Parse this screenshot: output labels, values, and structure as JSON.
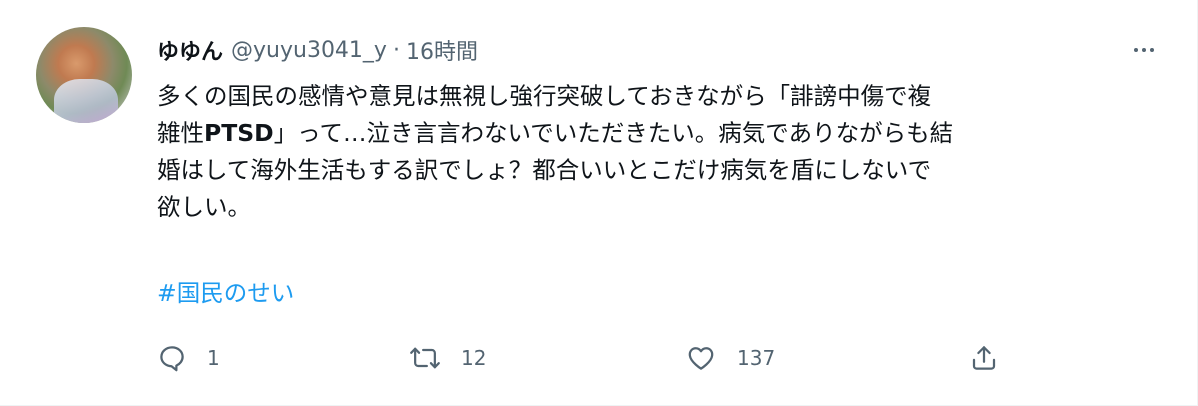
{
  "user": {
    "display_name": "ゆゆん",
    "handle": "@yuyu3041_y",
    "separator": "·",
    "time": "16時間"
  },
  "tweet": {
    "lines": [
      "多くの国民の感情や意見は無視し強行突破しておきながら「誹謗中傷で複",
      "雑性",
      "PTSD",
      "」って…泣き言言わないでいただきたい。病気でありながらも結",
      "婚はして海外生活もする訳でしょ？都合いいとこだけ病気を盾にしないで",
      "欲しい。"
    ],
    "hashtag": "#国民のせい"
  },
  "actions": {
    "reply_count": "1",
    "retweet_count": "12",
    "like_count": "137"
  },
  "icons": {
    "more": "more-icon",
    "reply": "reply-icon",
    "retweet": "retweet-icon",
    "like": "heart-icon",
    "share": "share-icon"
  },
  "colors": {
    "text": "#0f1419",
    "secondary": "#536471",
    "link": "#1d9bf0"
  }
}
